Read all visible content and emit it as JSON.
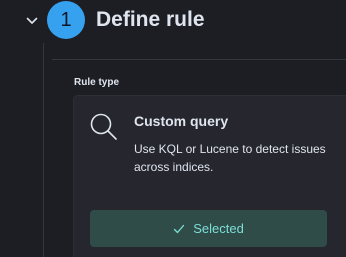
{
  "step": {
    "number": "1",
    "title": "Define rule",
    "toggle_icon": "chevron-down-icon"
  },
  "rule_type": {
    "label": "Rule type",
    "card": {
      "icon": "search-icon",
      "title": "Custom query",
      "description": "Use KQL or Lucene to detect issues across indices.",
      "button_label": "Selected",
      "button_icon": "check-icon"
    }
  },
  "colors": {
    "background": "#1d1e24",
    "card": "#25262e",
    "step_badge": "#36a2ef",
    "selected_button": "#2f4c48",
    "selected_text": "#7dded8",
    "text": "#dfe5ef"
  }
}
